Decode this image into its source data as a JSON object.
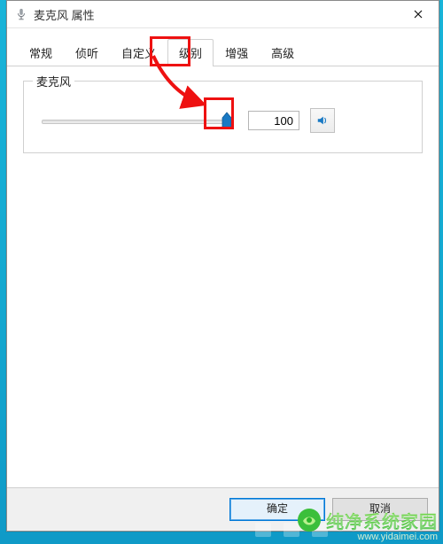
{
  "window": {
    "title": "麦克风 属性"
  },
  "tabs": {
    "items": [
      {
        "label": "常规"
      },
      {
        "label": "侦听"
      },
      {
        "label": "自定义"
      },
      {
        "label": "级别"
      },
      {
        "label": "增强"
      },
      {
        "label": "高级"
      }
    ]
  },
  "level": {
    "group_label": "麦克风",
    "value": "100"
  },
  "footer": {
    "ok": "确定",
    "cancel": "取消"
  },
  "watermark": {
    "cn": "纯净系统家园",
    "url": "www.yidaimei.com"
  }
}
